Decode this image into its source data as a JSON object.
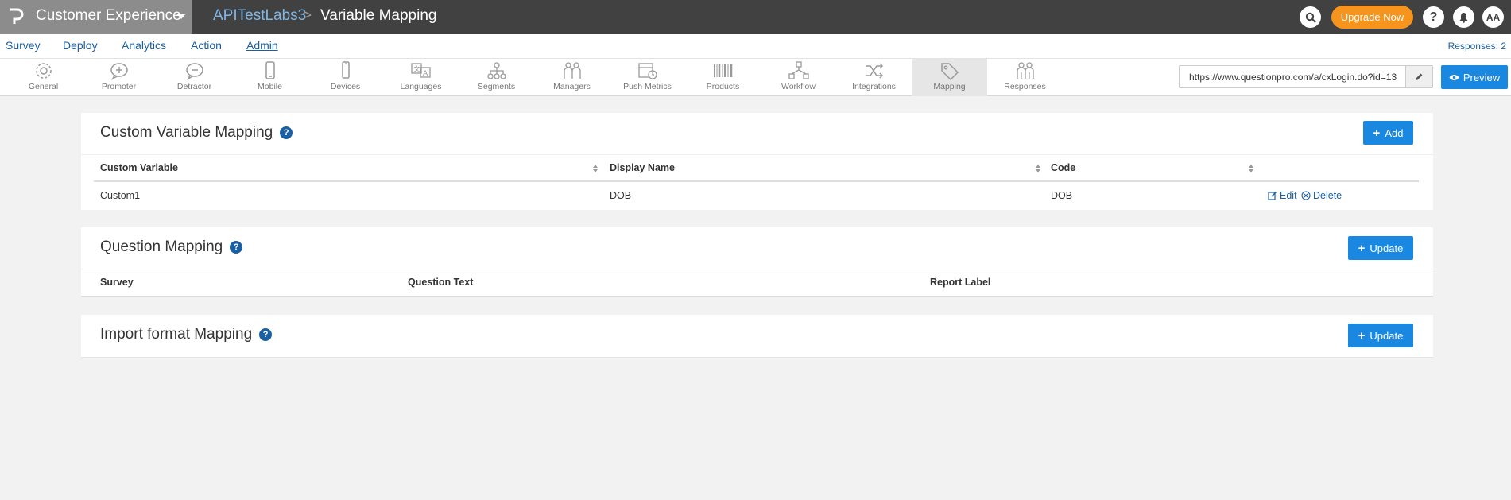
{
  "topbar": {
    "product_name": "Customer Experience",
    "breadcrumb_survey": "APITestLabs3",
    "breadcrumb_separator": ">",
    "page_title": "Variable Mapping",
    "upgrade_label": "Upgrade Now",
    "help_label": "?",
    "avatar_initials": "AA"
  },
  "nav": {
    "items": [
      "Survey",
      "Deploy",
      "Analytics",
      "Action",
      "Admin"
    ],
    "active": "Admin",
    "responses": "Responses: 2"
  },
  "toolbar": {
    "items": [
      {
        "label": "General",
        "icon": "gear-icon"
      },
      {
        "label": "Promoter",
        "icon": "promoter-icon"
      },
      {
        "label": "Detractor",
        "icon": "detractor-icon"
      },
      {
        "label": "Mobile",
        "icon": "mobile-icon"
      },
      {
        "label": "Devices",
        "icon": "devices-icon"
      },
      {
        "label": "Languages",
        "icon": "languages-icon"
      },
      {
        "label": "Segments",
        "icon": "segments-icon"
      },
      {
        "label": "Managers",
        "icon": "managers-icon"
      },
      {
        "label": "Push Metrics",
        "icon": "push-metrics-icon"
      },
      {
        "label": "Products",
        "icon": "barcode-icon"
      },
      {
        "label": "Workflow",
        "icon": "workflow-icon"
      },
      {
        "label": "Integrations",
        "icon": "integrations-icon"
      },
      {
        "label": "Mapping",
        "icon": "tag-icon"
      },
      {
        "label": "Responses",
        "icon": "responses-icon"
      }
    ],
    "active": "Mapping",
    "survey_url": "https://www.questionpro.com/a/cxLogin.do?id=13",
    "preview_label": "Preview"
  },
  "custom_variable_mapping": {
    "title": "Custom Variable Mapping",
    "add_label": "Add",
    "columns": [
      "Custom Variable",
      "Display Name",
      "Code"
    ],
    "rows": [
      {
        "custom_variable": "Custom1",
        "display_name": "DOB",
        "code": "DOB",
        "edit": "Edit",
        "delete": "Delete"
      }
    ]
  },
  "question_mapping": {
    "title": "Question Mapping",
    "update_label": "Update",
    "columns": [
      "Survey",
      "Question Text",
      "Report Label"
    ]
  },
  "import_format_mapping": {
    "title": "Import format Mapping",
    "update_label": "Update"
  },
  "colors": {
    "topbar": "#414141",
    "product_block": "#8c8c8c",
    "accent_blue": "#1a87e0",
    "link_blue": "#1b5fa3",
    "upgrade_orange": "#f7941d"
  }
}
